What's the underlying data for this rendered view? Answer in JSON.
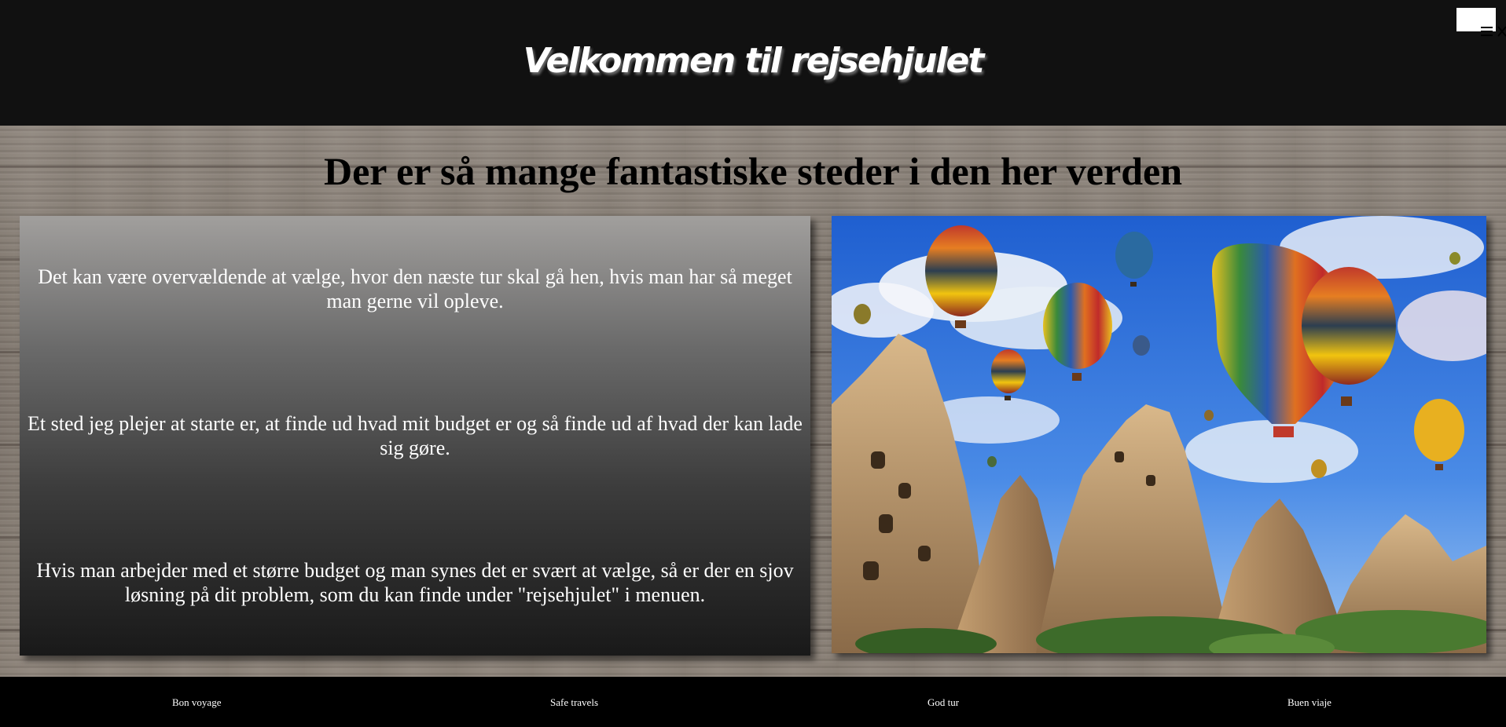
{
  "header": {
    "title": "Velkommen til rejsehjulet",
    "menu_icon": "hamburger-close-icon"
  },
  "main": {
    "heading": "Der er så mange fantastiske steder i den her verden",
    "paragraphs": [
      "Det kan være overvældende at vælge, hvor den næste tur skal gå hen, hvis man har så meget man gerne vil opleve.",
      "Et sted jeg plejer at starte er, at finde ud hvad mit budget er og så finde ud af hvad der kan lade sig gøre.",
      "Hvis man arbejder med et større budget og man synes det er svært at vælge, så er der en sjov løsning på dit problem, som du kan finde under \"rejsehjulet\" i menuen."
    ],
    "image_subject": "hot-air-balloons-over-rock-formations"
  },
  "footer": {
    "items": [
      "Bon voyage",
      "Safe travels",
      "God tur",
      "Buen viaje"
    ]
  },
  "colors": {
    "header_bg": "#111111",
    "footer_bg": "#000000",
    "title_text": "#ffffff",
    "heading_text": "#000000"
  }
}
